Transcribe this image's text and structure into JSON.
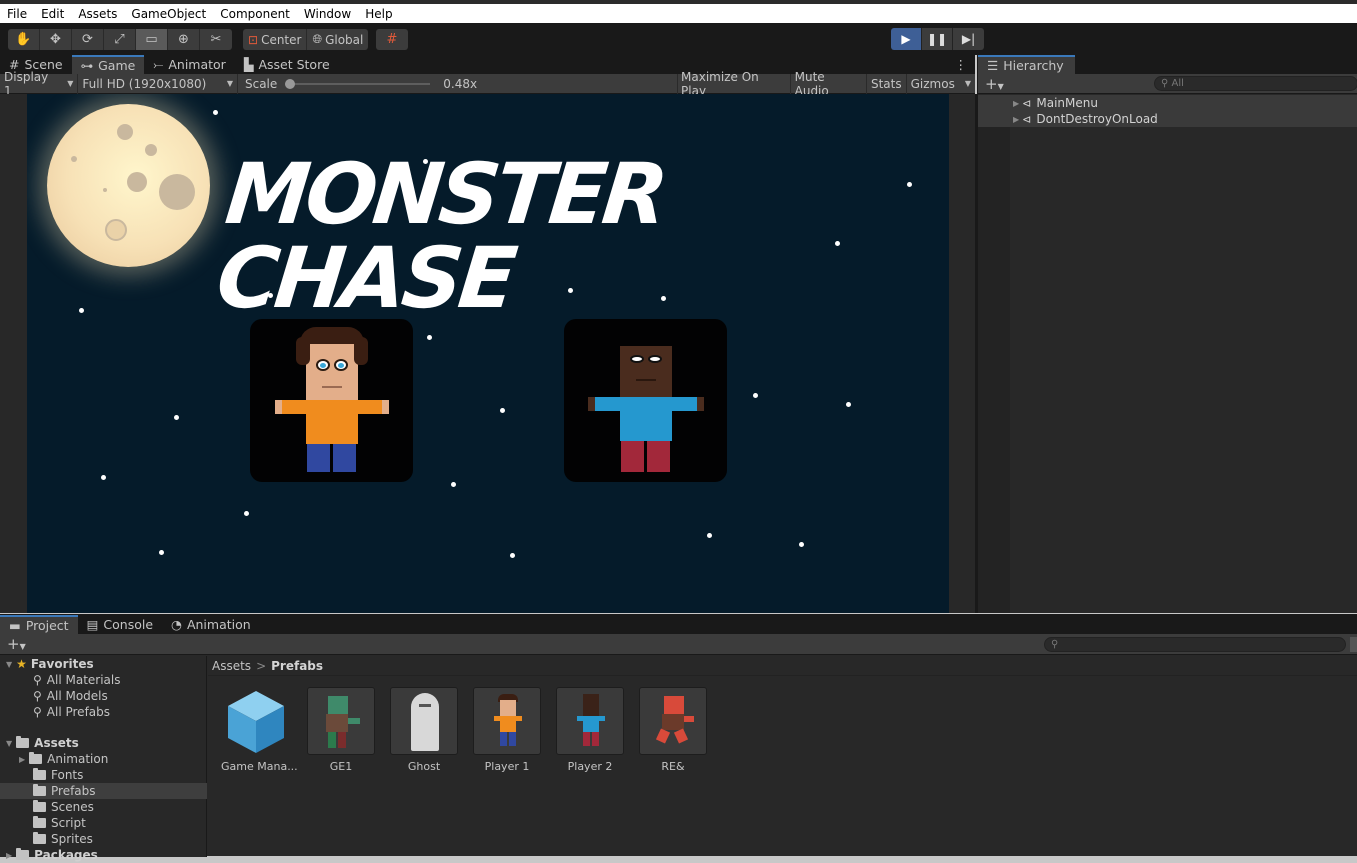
{
  "menu": [
    "File",
    "Edit",
    "Assets",
    "GameObject",
    "Component",
    "Window",
    "Help"
  ],
  "toolbar": {
    "tools": [
      "hand-tool",
      "move-tool",
      "rotate-tool",
      "scale-tool",
      "rect-tool",
      "transform-tool",
      "custom-tool"
    ],
    "pivot_label": "Center",
    "space_label": "Global"
  },
  "scene_tabs": [
    "Scene",
    "Game",
    "Animator",
    "Asset Store"
  ],
  "game_bar": {
    "display": "Display 1",
    "resolution": "Full HD (1920x1080)",
    "scale_label": "Scale",
    "scale_value": "0.48x",
    "scale_fraction": 0.0,
    "maximize": "Maximize On Play",
    "mute": "Mute Audio",
    "stats": "Stats",
    "gizmos": "Gizmos"
  },
  "game": {
    "title": "MONSTER CHASE",
    "background": "#051b2a"
  },
  "hierarchy": {
    "tab": "Hierarchy",
    "search_placeholder": "All",
    "items": [
      "MainMenu",
      "DontDestroyOnLoad"
    ]
  },
  "bottom_tabs": [
    "Project",
    "Console",
    "Animation"
  ],
  "project": {
    "favorites_label": "Favorites",
    "favorites": [
      "All Materials",
      "All Models",
      "All Prefabs"
    ],
    "assets_label": "Assets",
    "folders": [
      "Animation",
      "Fonts",
      "Prefabs",
      "Scenes",
      "Script",
      "Sprites"
    ],
    "packages_label": "Packages",
    "breadcrumb_root": "Assets",
    "breadcrumb_current": "Prefabs",
    "search_placeholder": ""
  },
  "prefabs": [
    "Game Mana...",
    "GE1",
    "Ghost",
    "Player 1",
    "Player 2",
    "RE&"
  ]
}
